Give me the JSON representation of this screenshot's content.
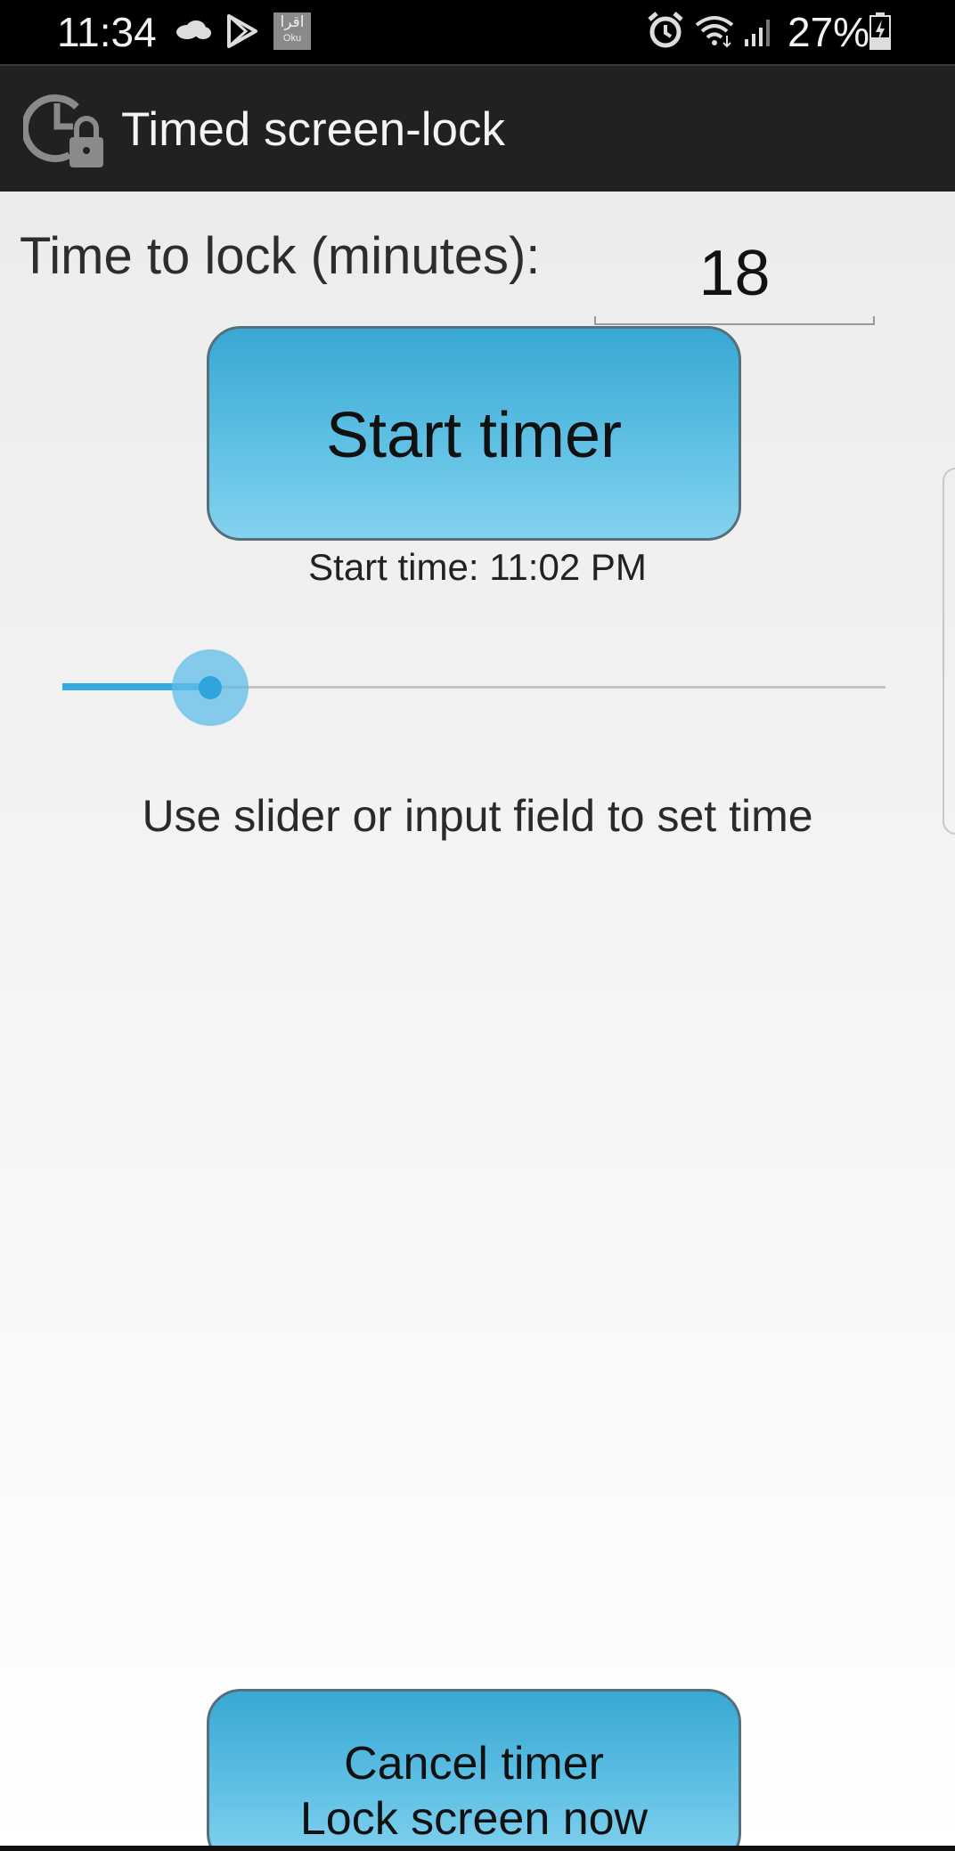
{
  "status_bar": {
    "time": "11:34",
    "battery_percent": "27%",
    "iqra_label_top": "اقرا",
    "iqra_label_bottom": "Oku",
    "icons": [
      "cloud-icon",
      "play-store-icon",
      "iqra-app-icon",
      "alarm-icon",
      "wifi-icon",
      "signal-icon",
      "battery-charging-icon"
    ]
  },
  "action_bar": {
    "title": "Timed screen-lock",
    "icon": "clock-lock-icon"
  },
  "main": {
    "time_label": "Time to lock (minutes):",
    "minutes_value": "18",
    "start_button_label": "Start timer",
    "start_time_text": "Start time: 11:02 PM",
    "slider_fraction": 0.18,
    "hint": "Use slider or input field to set time",
    "cancel_button_line1": "Cancel timer",
    "cancel_button_line2": "Lock screen now"
  },
  "colors": {
    "accent": "#35aadf",
    "button_top": "#38a8d4",
    "button_bottom": "#84d2ef",
    "action_bar": "#212121"
  }
}
